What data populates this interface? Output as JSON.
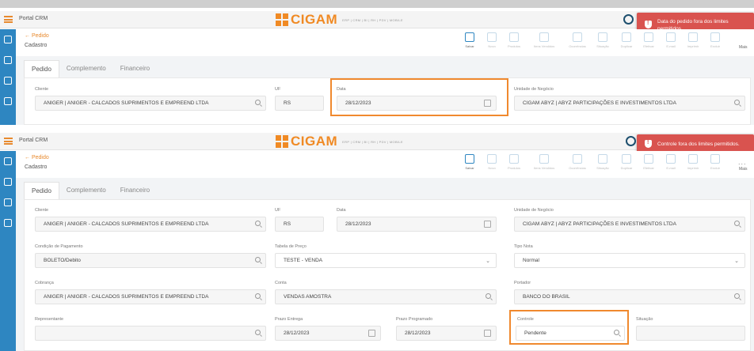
{
  "app": {
    "portal": "Portal CRM",
    "logo_text": "CIGAM",
    "logo_subtitle": "ERP | CRM | BI | RH | PDV | MOBILE",
    "colors": {
      "brand": "#f08a24",
      "accent": "#2e86c1",
      "alert": "#d9534f",
      "highlight": "#f0892e"
    }
  },
  "page": {
    "back_label": "Pedido",
    "breadcrumb": "Cadastro"
  },
  "toolbar": {
    "items": [
      {
        "label": "Salvar",
        "icon": "save-icon",
        "enabled": true
      },
      {
        "label": "Novo",
        "icon": "file-icon",
        "enabled": false
      },
      {
        "label": "Produtos",
        "icon": "box-icon",
        "enabled": false
      },
      {
        "label": "Itens Vendidos",
        "icon": "list-icon",
        "enabled": false
      },
      {
        "label": "Ocorrências",
        "icon": "alert-icon",
        "enabled": false
      },
      {
        "label": "Situação",
        "icon": "user-icon",
        "enabled": false
      },
      {
        "label": "Duplicar",
        "icon": "copy-icon",
        "enabled": false
      },
      {
        "label": "Efetivar",
        "icon": "check-icon",
        "enabled": false
      },
      {
        "label": "E-mail",
        "icon": "mail-icon",
        "enabled": false
      },
      {
        "label": "Imprimir",
        "icon": "print-icon",
        "enabled": false
      },
      {
        "label": "Excluir",
        "icon": "trash-icon",
        "enabled": false
      }
    ],
    "more_label": "Mais",
    "more_dots": "..."
  },
  "tabs": [
    "Pedido",
    "Complemento",
    "Financeiro"
  ],
  "screen1": {
    "toast": [
      "Data do pedido fora dos limites",
      "permitidos."
    ],
    "fields": {
      "cliente": {
        "label": "Cliente",
        "value": "ANIGER | ANIGER - CALCADOS SUPRIMENTOS E EMPREEND LTDA"
      },
      "uf": {
        "label": "UF",
        "value": "RS"
      },
      "data": {
        "label": "Data",
        "value": "28/12/2023"
      },
      "unidade": {
        "label": "Unidade de Negócio",
        "value": "CIGAM ABYZ | ABYZ PARTICIPAÇÕES E INVESTIMENTOS LTDA"
      }
    }
  },
  "screen2": {
    "toast": [
      "Controle fora dos limites permitidos."
    ],
    "fields": {
      "cliente": {
        "label": "Cliente",
        "value": "ANIGER | ANIGER - CALCADOS SUPRIMENTOS E EMPREEND LTDA"
      },
      "uf": {
        "label": "UF",
        "value": "RS"
      },
      "data": {
        "label": "Data",
        "value": "28/12/2023"
      },
      "unidade": {
        "label": "Unidade de Negócio",
        "value": "CIGAM ABYZ | ABYZ PARTICIPAÇÕES E INVESTIMENTOS LTDA"
      },
      "condicao": {
        "label": "Condição de Pagamento",
        "value": "BOLETO/Debito"
      },
      "tabela": {
        "label": "Tabela de Preço",
        "value": "TESTE - VENDA"
      },
      "tipo_nota": {
        "label": "Tipo Nota",
        "value": "Normal"
      },
      "cobranca": {
        "label": "Cobrança",
        "value": "ANIGER | ANIGER - CALCADOS SUPRIMENTOS E EMPREEND LTDA"
      },
      "conta": {
        "label": "Conta",
        "value": "VENDAS AMOSTRA"
      },
      "portador": {
        "label": "Portador",
        "value": "BANCO DO BRASIL"
      },
      "representante": {
        "label": "Representante",
        "value": ""
      },
      "prazo_entrega": {
        "label": "Prazo Entrega",
        "value": "28/12/2023"
      },
      "prazo_programado": {
        "label": "Prazo Programado",
        "value": "28/12/2023"
      },
      "controle": {
        "label": "Controle",
        "value": "Pendente"
      },
      "situacao": {
        "label": "Situação",
        "value": ""
      }
    }
  }
}
